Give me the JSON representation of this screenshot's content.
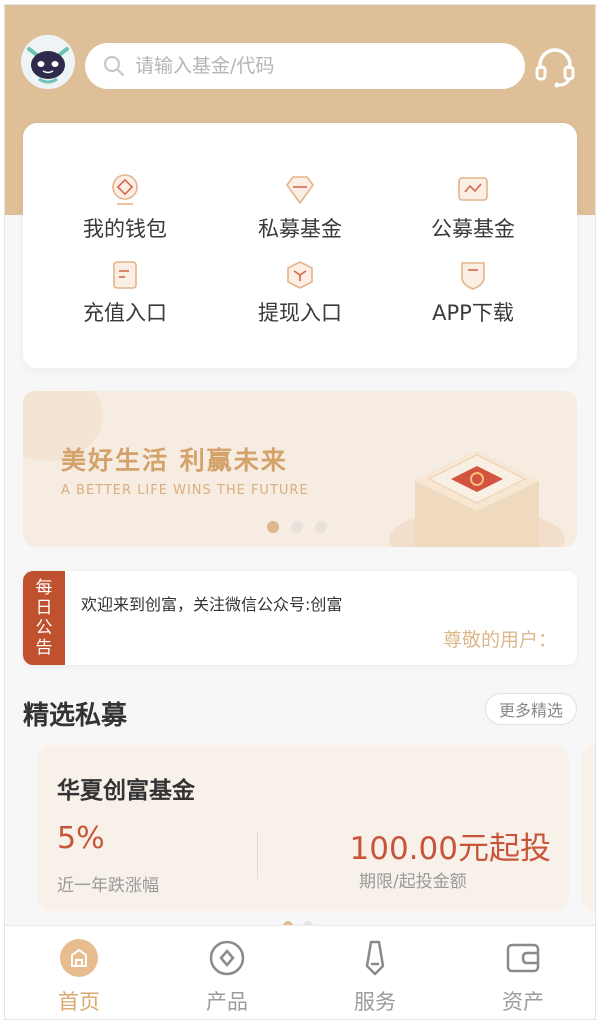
{
  "colors": {
    "hero": "#dfbf98",
    "accent": "#dcb88c",
    "red": "#c8553a",
    "notice_tag": "#c0512f"
  },
  "header": {
    "avatar_icon": "robot-avatar-icon",
    "search_placeholder": "请输入基金/代码",
    "support_icon": "headset-icon"
  },
  "menu": {
    "items": [
      {
        "label": "我的钱包",
        "icon": "wallet-icon"
      },
      {
        "label": "私募基金",
        "icon": "diamond-icon"
      },
      {
        "label": "公募基金",
        "icon": "chart-icon"
      },
      {
        "label": "充值入口",
        "icon": "document-icon"
      },
      {
        "label": "提现入口",
        "icon": "box-icon"
      },
      {
        "label": "APP下载",
        "icon": "shield-download-icon"
      }
    ]
  },
  "banner": {
    "title": "美好生活 利赢未来",
    "subtitle": "A BETTER LIFE WINS THE FUTURE",
    "active_slide": 0,
    "slide_count": 3
  },
  "notice": {
    "tag": [
      "每",
      "日",
      "公",
      "告"
    ],
    "text": "欢迎来到创富，关注微信公众号:创富",
    "scroll_text": "尊敬的用户："
  },
  "featured": {
    "title": "精选私募",
    "more_label": "更多精选",
    "card": {
      "name": "华夏创富基金",
      "rate": "5%",
      "rate_label": "近一年跌涨幅",
      "min_invest": "100.00元起投",
      "min_label": "期限/起投金额"
    }
  },
  "tabbar": {
    "items": [
      {
        "label": "首页",
        "icon": "home-icon",
        "active": true
      },
      {
        "label": "产品",
        "icon": "product-icon",
        "active": false
      },
      {
        "label": "服务",
        "icon": "service-icon",
        "active": false
      },
      {
        "label": "资产",
        "icon": "assets-wallet-icon",
        "active": false
      }
    ]
  }
}
